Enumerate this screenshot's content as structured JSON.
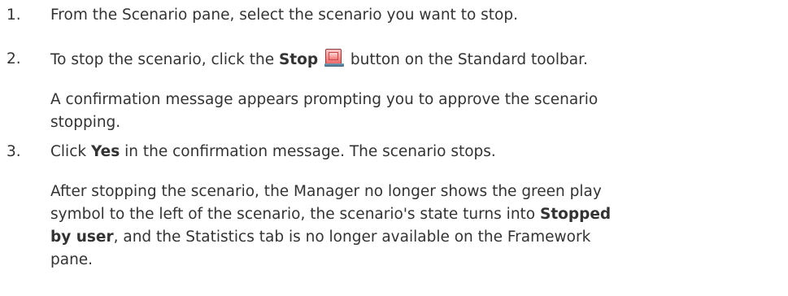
{
  "steps": [
    {
      "number": "1.",
      "text": "From the Scenario pane, select the scenario you want to stop."
    },
    {
      "number": "2.",
      "text_before": "To stop the scenario, click the ",
      "bold": "Stop",
      "text_after": " button on the Standard toolbar.",
      "icon": "stop-icon",
      "note_line1": "A confirmation message appears prompting you to approve the scenario",
      "note_line2": "stopping."
    },
    {
      "number": "3.",
      "text_before": "Click ",
      "bold": "Yes",
      "text_after": " in the confirmation message. The scenario stops.",
      "note_line1": "After stopping the scenario, the Manager no longer shows the green play",
      "note_line2_before": "symbol to the left of the scenario, the scenario's state turns into ",
      "note_line2_bold": "Stopped",
      "note_line3_bold": "by user",
      "note_line3_after": ", and the Statistics tab is no longer available on the Framework",
      "note_line4": "pane."
    }
  ]
}
